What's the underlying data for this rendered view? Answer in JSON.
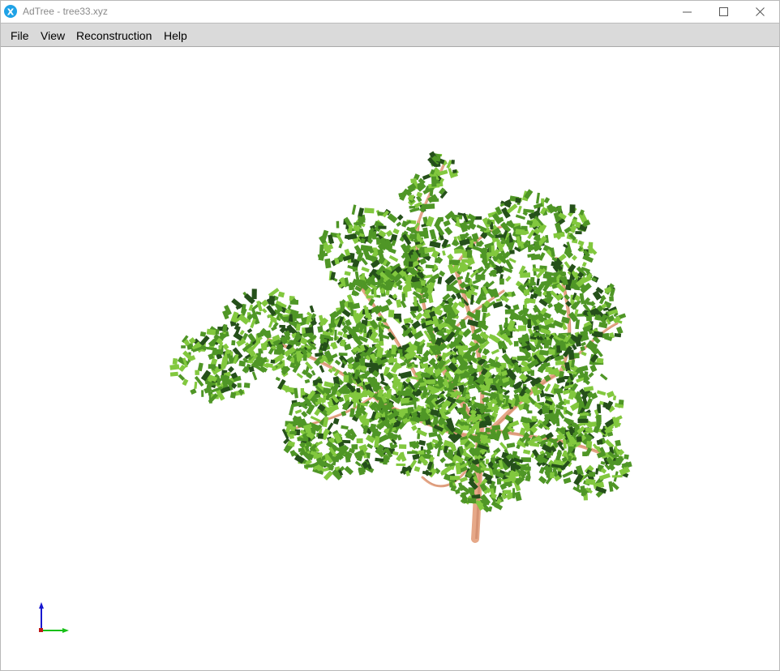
{
  "window": {
    "title": "AdTree - tree33.xyz",
    "app_icon_glyph": "X",
    "buttons": [
      "minimize-icon",
      "maximize-icon",
      "close-icon"
    ]
  },
  "menu": {
    "items": [
      "File",
      "View",
      "Reconstruction",
      "Help"
    ]
  },
  "viewport": {
    "background": "#ffffff",
    "colors": {
      "leaf_light": "#82c83e",
      "leaf_mid": "#4f9626",
      "leaf_dark": "#25501a",
      "branch": "#e6a888",
      "branch_shade": "#c98466",
      "axis_x": "#18c018",
      "axis_y": "#1818d0",
      "axis_z": "#c01818"
    }
  }
}
